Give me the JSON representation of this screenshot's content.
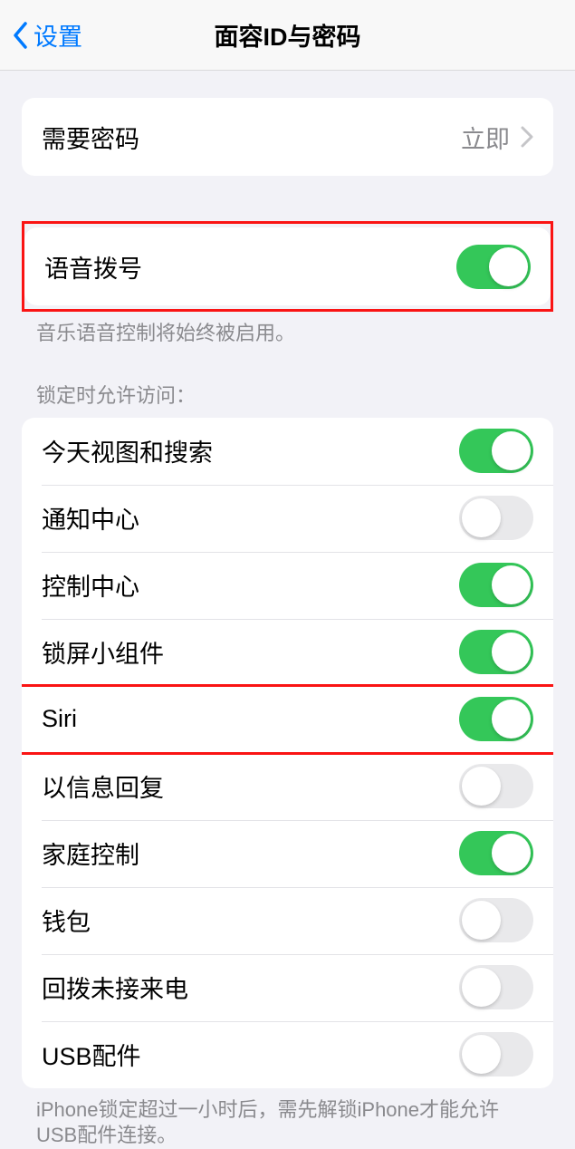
{
  "nav": {
    "back": "设置",
    "title": "面容ID与密码"
  },
  "require_passcode": {
    "label": "需要密码",
    "value": "立即"
  },
  "voice_dial": {
    "label": "语音拨号",
    "on": true,
    "footer": "音乐语音控制将始终被启用。"
  },
  "lock_access": {
    "header": "锁定时允许访问：",
    "items": [
      {
        "label": "今天视图和搜索",
        "on": true
      },
      {
        "label": "通知中心",
        "on": false
      },
      {
        "label": "控制中心",
        "on": true
      },
      {
        "label": "锁屏小组件",
        "on": true
      },
      {
        "label": "Siri",
        "on": true
      },
      {
        "label": "以信息回复",
        "on": false
      },
      {
        "label": "家庭控制",
        "on": true
      },
      {
        "label": "钱包",
        "on": false
      },
      {
        "label": "回拨未接来电",
        "on": false
      },
      {
        "label": "USB配件",
        "on": false
      }
    ],
    "footer": "iPhone锁定超过一小时后，需先解锁iPhone才能允许USB配件连接。"
  },
  "highlighted_indices": [
    4
  ]
}
